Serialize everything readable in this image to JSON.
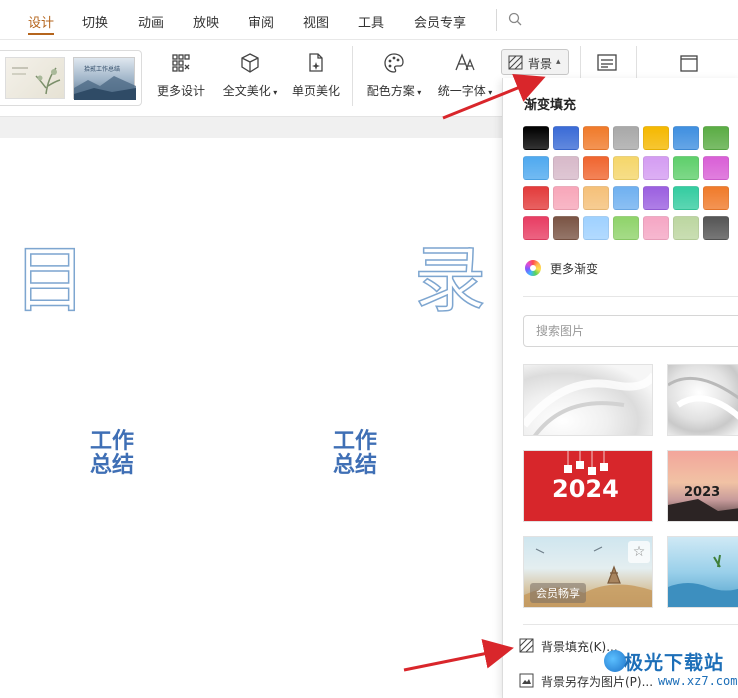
{
  "menu": {
    "tabs": [
      "设计",
      "切换",
      "动画",
      "放映",
      "审阅",
      "视图",
      "工具",
      "会员专享"
    ],
    "active_tab": "设计"
  },
  "ribbon": {
    "more_design": "更多设计",
    "full_beautify": "全文美化",
    "page_beautify": "单页美化",
    "color_scheme": "配色方案",
    "unify_font": "统一字体",
    "background": "背景",
    "theme_thumb_title": "拾贰工作总结"
  },
  "slide": {
    "char_left": "目",
    "char_right": "录",
    "work_left": "工作\n总结",
    "work_right": "工作\n总结"
  },
  "panel": {
    "gradient_title": "渐变填充",
    "more_gradient": "更多渐变",
    "search_placeholder": "搜索图片",
    "swatches": [
      [
        "#000000",
        "#3a6bd6",
        "#f07a2a",
        "#a8a8a8",
        "#f5b800",
        "#3f8fe0",
        "#5aac44",
        "#7fd0e8"
      ],
      [
        "#4fa9ef",
        "#d7b9c9",
        "#f0652f",
        "#f5d66a",
        "#d49cf2",
        "#5ecf6b",
        "#d95fd6",
        "#6fc9ef"
      ],
      [
        "#e33b3b",
        "#f7a6b9",
        "#f5c078",
        "#6fb0f0",
        "#9b5fe0",
        "#34cca0",
        "#f07a2a",
        "#f1d84f"
      ],
      [
        "#e83d63",
        "#7a5444",
        "#9fd1ff",
        "#8fd36a",
        "#f5a6c4",
        "#bcd6a0",
        "#555555",
        "#9bd8f0"
      ]
    ],
    "thumb_year_2024": "2024",
    "thumb_year_2023": "2023",
    "member_badge": "会员畅享",
    "bg_fill": "背景填充(K)...",
    "bg_save_image": "背景另存为图片(P)..."
  },
  "watermark": {
    "title": "极光下载站",
    "url": "www.xz7.com"
  },
  "colors": {
    "accent": "#b5651d",
    "arrow": "#d9262b",
    "slide_text": "#3f6fb5",
    "watermark": "#1d6fb8"
  }
}
